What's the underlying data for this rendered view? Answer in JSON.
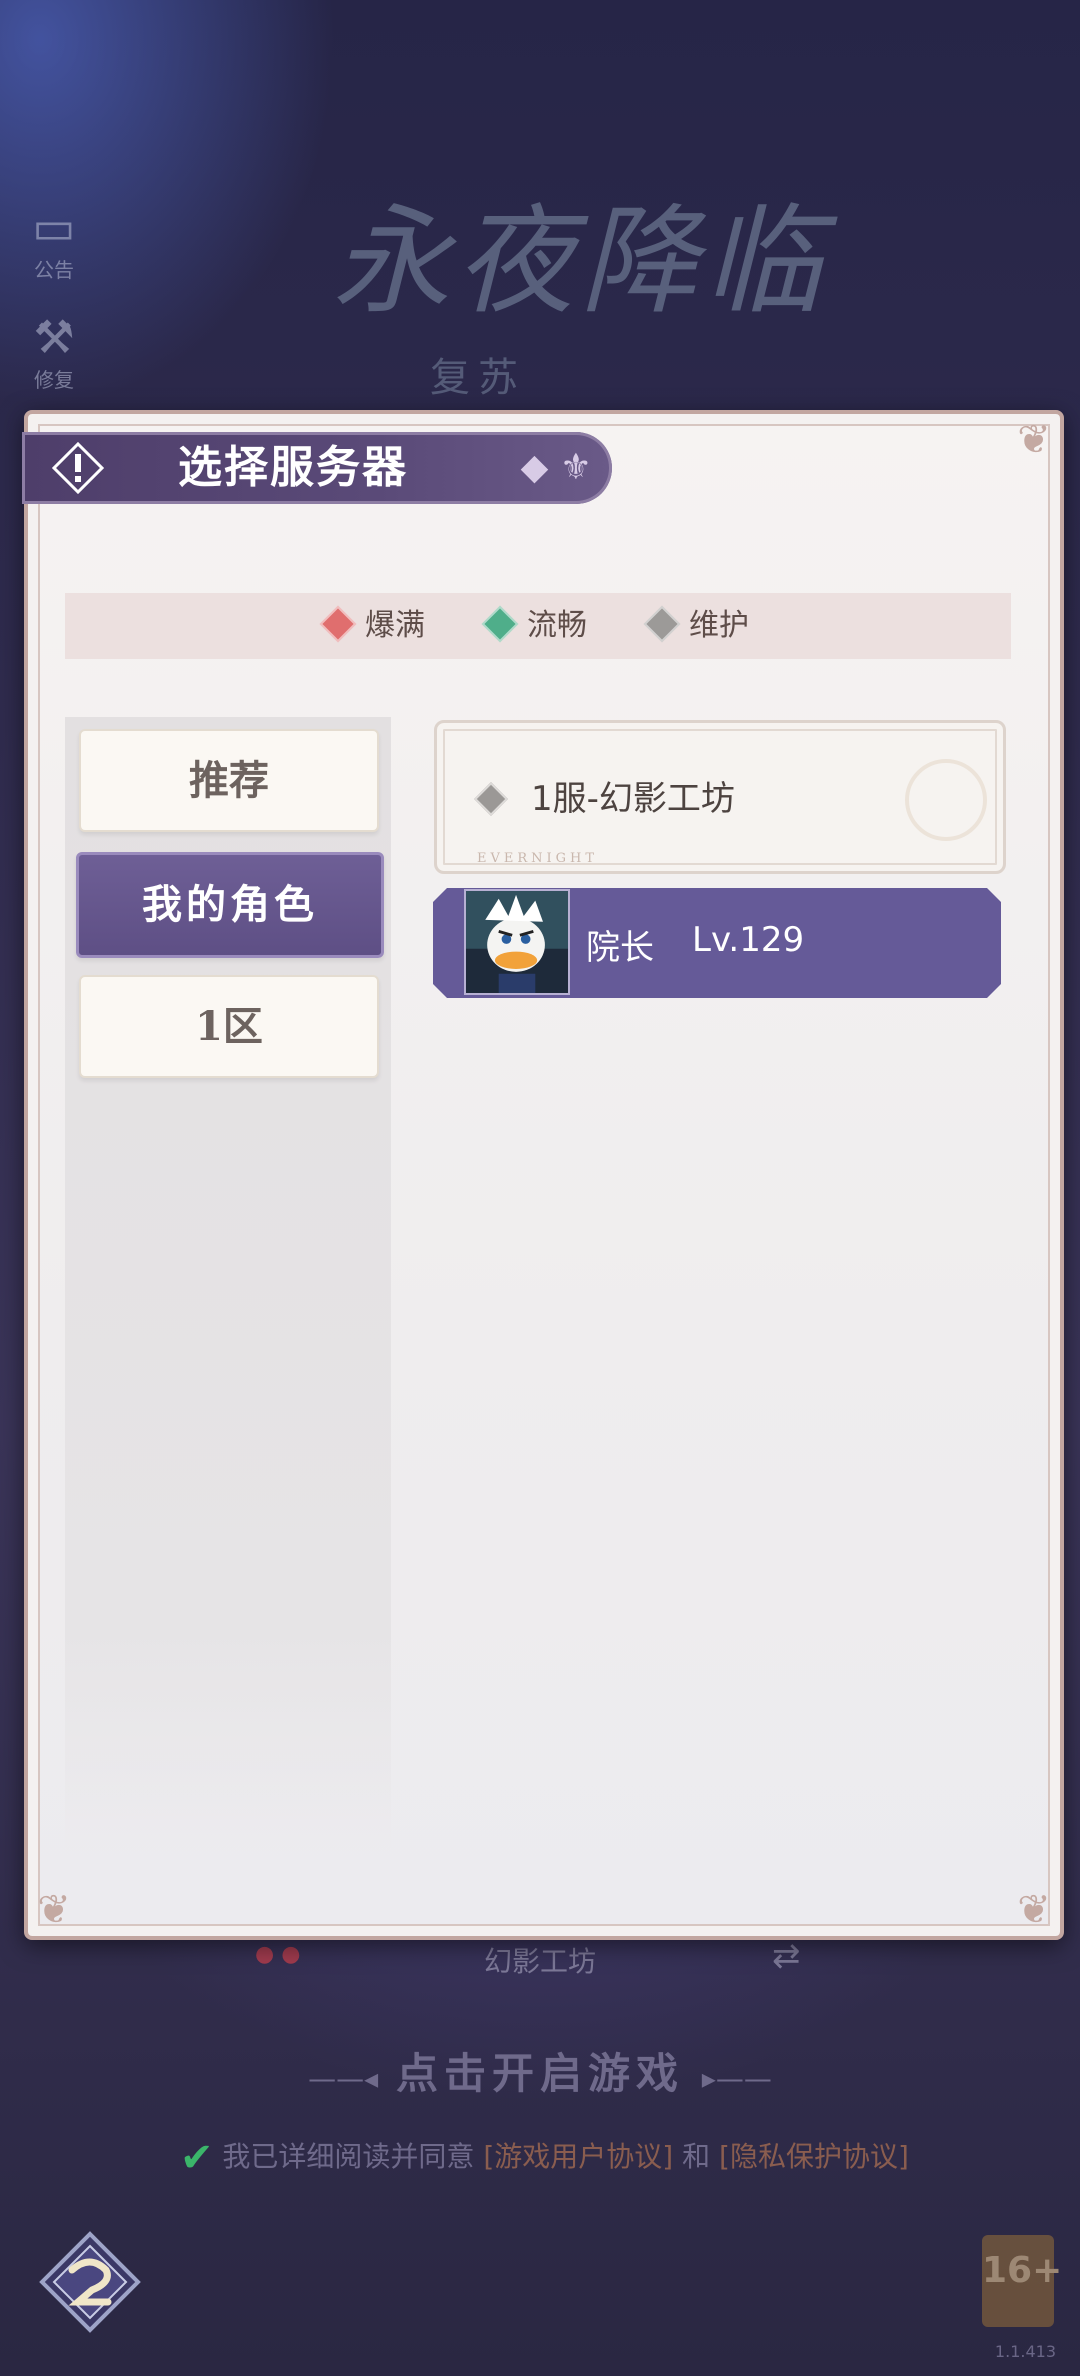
{
  "side_buttons": [
    {
      "label": "公告",
      "icon": "notice-icon"
    },
    {
      "label": "修复",
      "icon": "repair-icon"
    }
  ],
  "logo": {
    "title": "永夜降临",
    "subtitle": "复苏"
  },
  "dialog": {
    "title": "选择服务器",
    "legend": [
      {
        "label": "爆满",
        "color": "#e06e6e"
      },
      {
        "label": "流畅",
        "color": "#4fae8a"
      },
      {
        "label": "维护",
        "color": "#9c9a98"
      }
    ],
    "tabs": [
      {
        "label": "推荐",
        "active": false
      },
      {
        "label": "我的角色",
        "active": true
      },
      {
        "label": "1区",
        "active": false
      }
    ],
    "server": {
      "name": "1服-幻影工坊",
      "tag": "EVERNIGHT",
      "status_color": "#9c9a98"
    },
    "role": {
      "name": "院长",
      "level": "Lv.129"
    }
  },
  "behind": {
    "server_name": "幻影工坊",
    "start_text": "点击开启游戏",
    "agree_text": "我已详细阅读并同意",
    "user_agreement": "[游戏用户协议]",
    "and_text": "和",
    "privacy_agreement": "[隐私保护协议]",
    "age_rating": "16+",
    "version": "1.1.413"
  }
}
